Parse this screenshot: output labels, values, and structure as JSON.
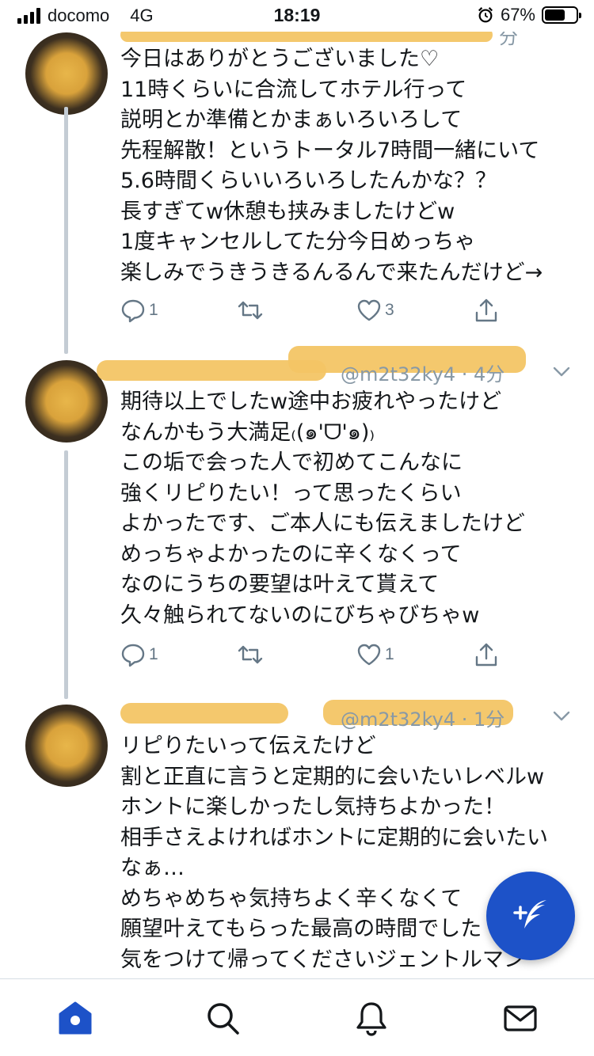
{
  "status_bar": {
    "carrier": "docomo",
    "network": "4G",
    "time": "18:19",
    "battery_pct": "67%",
    "battery_level": 0.67
  },
  "tweets": [
    {
      "meta_visible": "分",
      "lines": [
        "今日はありがとうございました♡",
        "11時くらいに合流してホテル行って",
        "説明とか準備とかまぁいろいろして",
        "先程解散！というトータル7時間一緒にいて",
        "5.6時間くらいいろいろしたんかな？？",
        "長すぎてw休憩も挟みましたけどw",
        "1度キャンセルしてた分今日めっちゃ",
        "楽しみでうきうきるんるんで来たんだけど→"
      ],
      "reply_count": "1",
      "retweet_count": "",
      "like_count": "3"
    },
    {
      "meta_visible": "@m2t32ky4 · 4分",
      "lines": [
        "期待以上でしたw途中お疲れやったけど",
        "なんかもう大満足₍(๑'ᗜ'๑)₎",
        "この垢で会った人で初めてこんなに",
        "強くリピりたい！って思ったくらい",
        "よかったです、ご本人にも伝えましたけど",
        "めっちゃよかったのに辛くなくって",
        "なのにうちの要望は叶えて貰えて",
        "久々触られてないのにびちゃびちゃw"
      ],
      "reply_count": "1",
      "retweet_count": "",
      "like_count": "1"
    },
    {
      "meta_visible": "@m2t32ky4 · 1分",
      "lines": [
        "リピりたいって伝えたけど",
        "割と正直に言うと定期的に会いたいレベルw",
        "ホントに楽しかったし気持ちよかった！",
        "相手さえよければホントに定期的に会いたい",
        "なぁ…",
        "めちゃめちゃ気持ちよく辛くなくて",
        "願望叶えてもらった最高の時間でした",
        "気をつけて帰ってくださいジェントルマン"
      ]
    }
  ],
  "icons": {
    "reply": "reply-icon",
    "retweet": "retweet-icon",
    "like": "heart-icon",
    "share": "share-icon",
    "more": "chevron-down-icon",
    "compose": "compose-tweet-icon",
    "tabs": [
      "home-icon",
      "search-icon",
      "notifications-icon",
      "messages-icon"
    ]
  },
  "colors": {
    "accent": "#1d52c8",
    "muted": "#657786",
    "redaction": "#f3c565"
  }
}
